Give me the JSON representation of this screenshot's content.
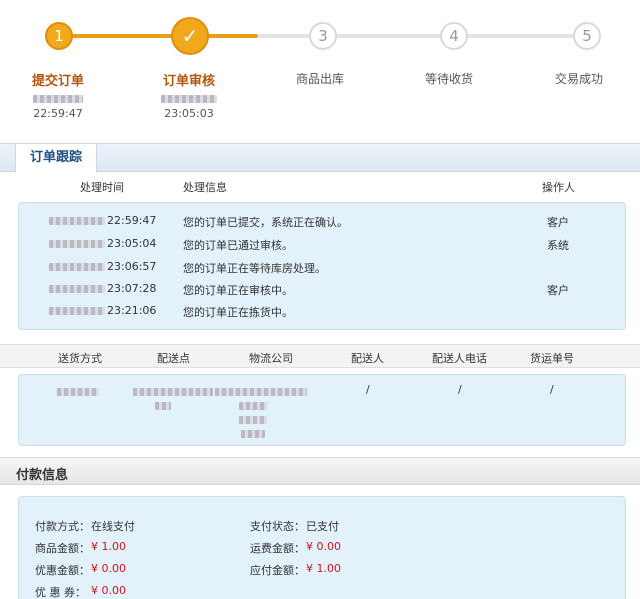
{
  "steps": [
    {
      "number": "1",
      "label": "提交订单",
      "time": "22:59:47"
    },
    {
      "number": "✓",
      "label": "订单审核",
      "time": "23:05:03"
    },
    {
      "number": "3",
      "label": "商品出库"
    },
    {
      "number": "4",
      "label": "等待收货"
    },
    {
      "number": "5",
      "label": "交易成功"
    }
  ],
  "tracking": {
    "tab_label": "订单跟踪",
    "headers": {
      "time": "处理时间",
      "info": "处理信息",
      "operator": "操作人"
    },
    "rows": [
      {
        "time": "22:59:47",
        "info": "您的订单已提交，系统正在确认。",
        "operator": "客户"
      },
      {
        "time": "23:05:04",
        "info": "您的订单已通过审核。",
        "operator": "系统"
      },
      {
        "time": "23:06:57",
        "info": "您的订单正在等待库房处理。",
        "operator": ""
      },
      {
        "time": "23:07:28",
        "info": "您的订单正在审核中。",
        "operator": "客户"
      },
      {
        "time": "23:21:06",
        "info": "您的订单正在拣货中。",
        "operator": ""
      }
    ]
  },
  "delivery": {
    "headers": [
      "送货方式",
      "配送点",
      "物流公司",
      "配送人",
      "配送人电话",
      "货运单号"
    ],
    "values": {
      "courier": "/",
      "phone": "/",
      "waybill": "/"
    }
  },
  "payment": {
    "section_title": "付款信息",
    "method_label": "付款方式：",
    "method_value": "在线支付",
    "status_label": "支付状态：",
    "status_value": "已支付",
    "goods_label": "商品金额：",
    "goods_value": "¥ 1.00",
    "shipping_label": "运费金额：",
    "shipping_value": "¥ 0.00",
    "discount_label": "优惠金额：",
    "discount_value": "¥ 0.00",
    "payable_label": "应付金额：",
    "payable_value": "¥ 1.00",
    "coupon_label": "优 惠 券：",
    "coupon_value": "¥ 0.00"
  }
}
